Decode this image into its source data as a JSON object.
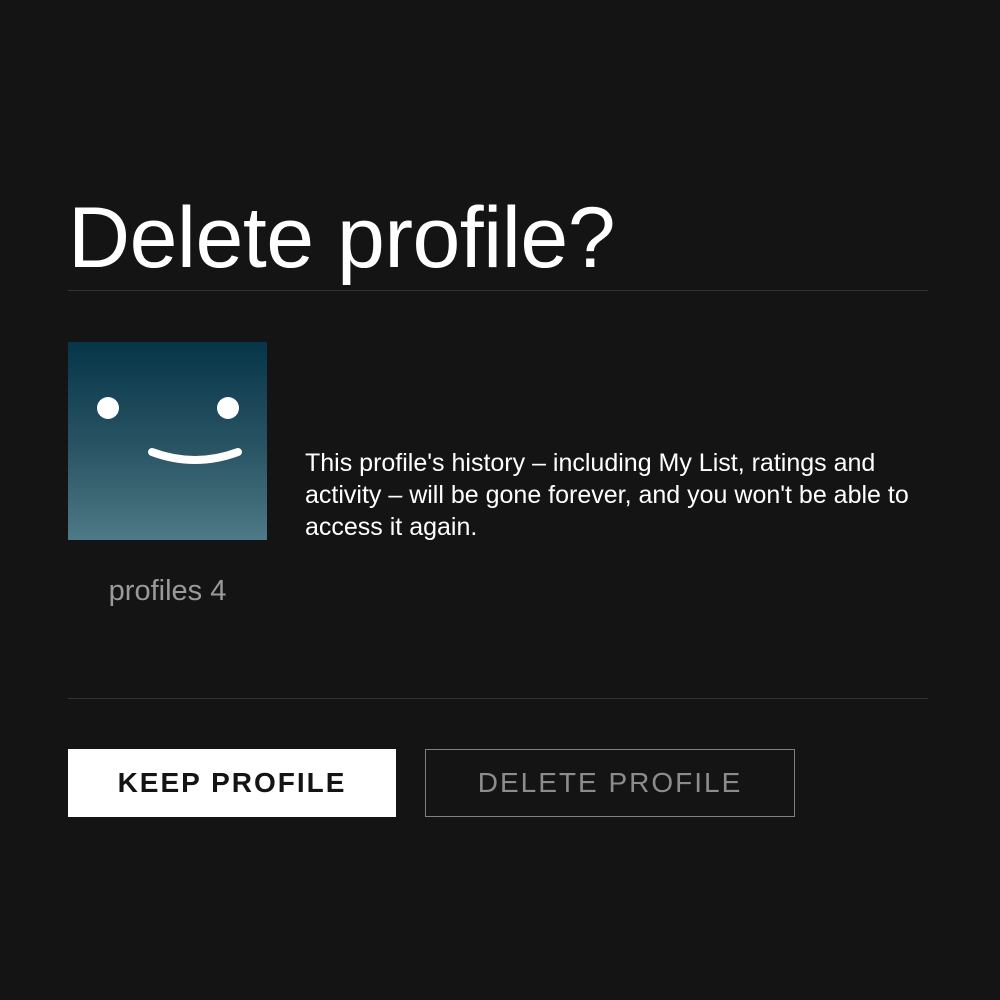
{
  "dialog": {
    "title": "Delete profile?",
    "warning_text": "This profile's history – including My List, ratings and activity – will be gone forever, and you won't be able to access it again."
  },
  "profile": {
    "name": "profiles 4",
    "avatar_icon": "smiley-face-icon",
    "avatar_colors": {
      "top": "#063549",
      "bottom": "#4d7a86"
    }
  },
  "buttons": {
    "keep_label": "KEEP PROFILE",
    "delete_label": "DELETE PROFILE"
  },
  "colors": {
    "background": "#141414",
    "text": "#ffffff",
    "muted_text": "#9a9a9a",
    "divider": "#333333"
  }
}
